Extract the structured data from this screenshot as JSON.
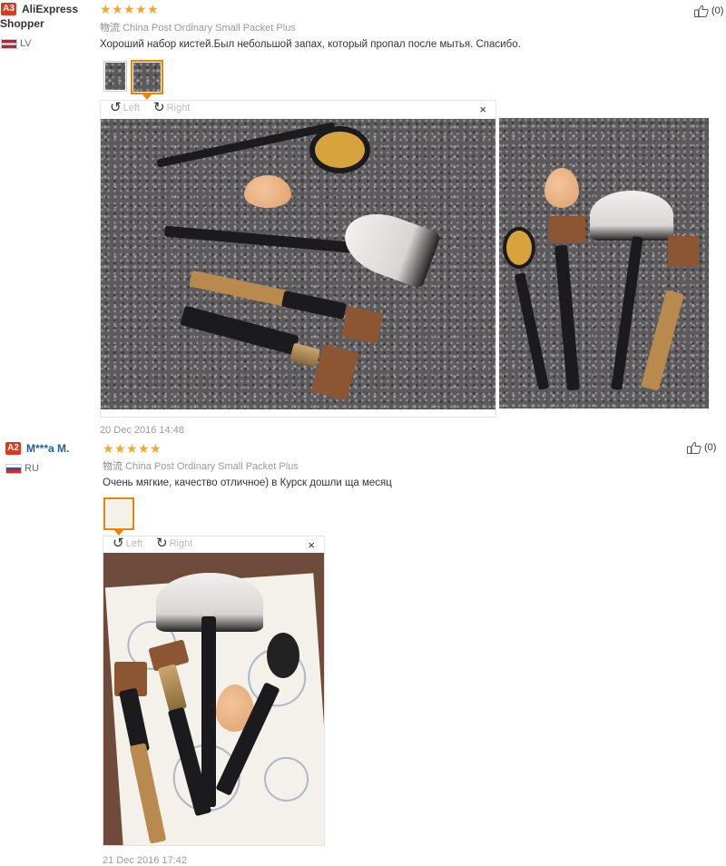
{
  "reviews": [
    {
      "badge": "A3",
      "user": "AliExpress Shopper",
      "country": "LV",
      "rating": 5,
      "shipping_label": "物流",
      "shipping": "China Post Ordinary Small Packet Plus",
      "text": "Хороший набор кистей.Был небольшой запах, который пропал после мытья. Спасибо.",
      "viewer": {
        "left": "Left",
        "right": "Right",
        "close": "×"
      },
      "date": "20 Dec 2016 14:48",
      "likes": "(0)"
    },
    {
      "badge": "A2",
      "user": "M***a M.",
      "country": "RU",
      "rating": 5,
      "shipping_label": "物流",
      "shipping": "China Post Ordinary Small Packet Plus",
      "text": "Очень мягкие, качество отличное) в Курск дошли ща месяц",
      "viewer": {
        "left": "Left",
        "right": "Right",
        "close": "×"
      },
      "date": "21 Dec 2016 17:42",
      "likes": "(0)"
    }
  ],
  "colors": {
    "star": "#f5a623",
    "badge": "#d9391f",
    "thumb_active": "#f08200",
    "user_link": "#1a5ea8"
  },
  "icons": [
    "star-icon",
    "rotate-left-icon",
    "rotate-right-icon",
    "close-icon",
    "thumbs-up-icon",
    "flag-lv-icon",
    "flag-ru-icon"
  ]
}
